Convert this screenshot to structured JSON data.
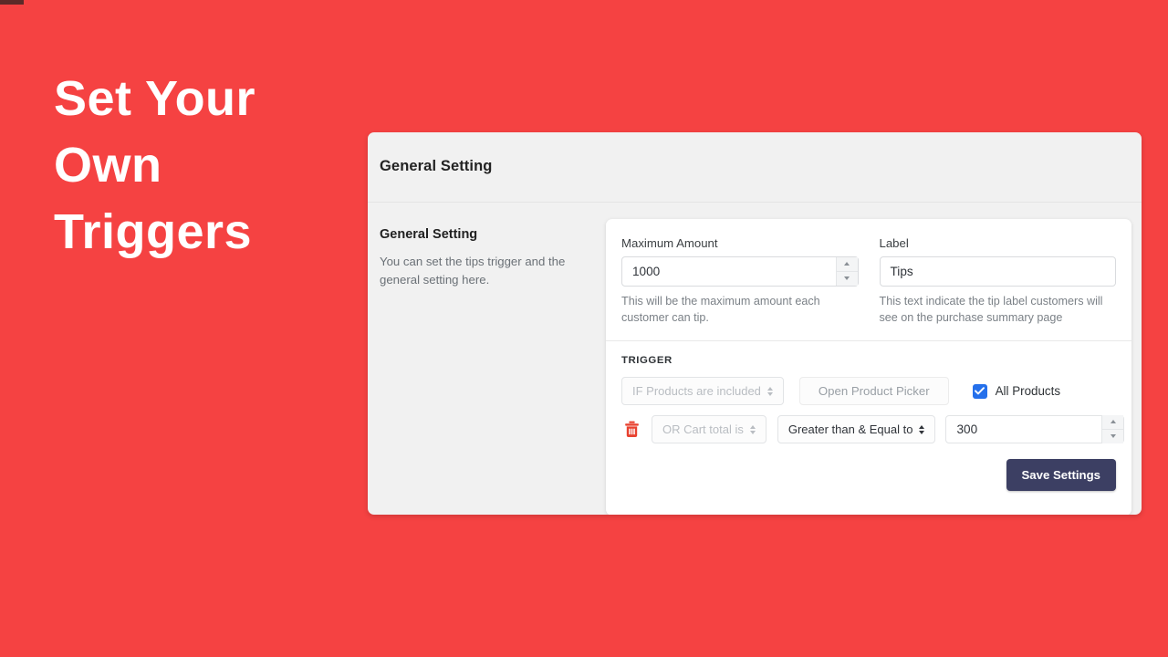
{
  "theme": {
    "background_color": "#f54242",
    "panel_color": "#f1f1f1",
    "accent_checkbox_color": "#2570eb",
    "save_button_color": "#3c3f63",
    "trash_icon_color": "#e8412f"
  },
  "headline": {
    "line1": "Set Your",
    "line2": "Own",
    "line3": "Triggers"
  },
  "panel": {
    "header_title": "General Setting",
    "description": {
      "title": "General Setting",
      "text": "You can set the tips trigger and the general setting here."
    },
    "fields": {
      "maximum_amount": {
        "label": "Maximum Amount",
        "value": "1000",
        "helper": "This will be the maximum amount each customer can tip."
      },
      "label_field": {
        "label": "Label",
        "value": "Tips",
        "helper": "This text indicate the tip label customers will see on the purchase summary page"
      }
    },
    "trigger": {
      "heading": "TRIGGER",
      "row1": {
        "condition_select": "IF Products are included",
        "product_picker_button": "Open Product Picker",
        "all_products_checkbox_label": "All Products",
        "all_products_checked": true
      },
      "row2": {
        "condition_select": "OR Cart total is",
        "operator_select": "Greater than & Equal to",
        "value": "300"
      }
    },
    "save_button": "Save Settings"
  }
}
